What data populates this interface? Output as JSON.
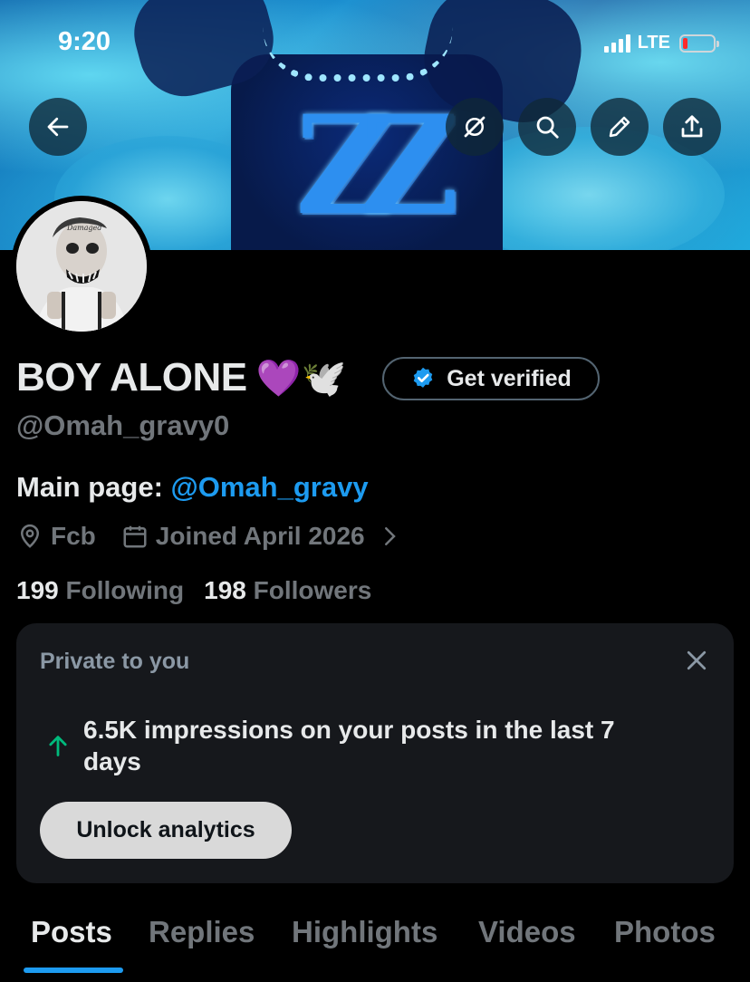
{
  "status_bar": {
    "time": "9:20",
    "network": "LTE",
    "battery_level_percent": 8,
    "battery_color": "#ff2a2a"
  },
  "banner": {
    "pendant_text": "ZZ",
    "theme_color": "#1b8fd0"
  },
  "nav": {
    "back_icon": "arrow-left-icon",
    "grok_icon": "grok-icon",
    "search_icon": "search-icon",
    "edit_icon": "pencil-icon",
    "share_icon": "share-icon"
  },
  "profile": {
    "display_name": "BOY ALONE",
    "name_emojis": "💜🕊️",
    "verify_label": "Get verified",
    "handle": "@Omah_gravy0",
    "bio_prefix": "Main page: ",
    "bio_mention": "@Omah_gravy",
    "location": "Fcb",
    "joined": "Joined April 2026",
    "following_count": "199",
    "following_label": "Following",
    "followers_count": "198",
    "followers_label": "Followers",
    "accent_color": "#1d9bf0"
  },
  "private_card": {
    "title": "Private to you",
    "message": "6.5K impressions on your posts in the last 7 days",
    "button_label": "Unlock analytics",
    "trend_color": "#00ba7c"
  },
  "tabs": {
    "items": [
      "Posts",
      "Replies",
      "Highlights",
      "Videos",
      "Photos"
    ],
    "active": "Posts"
  }
}
